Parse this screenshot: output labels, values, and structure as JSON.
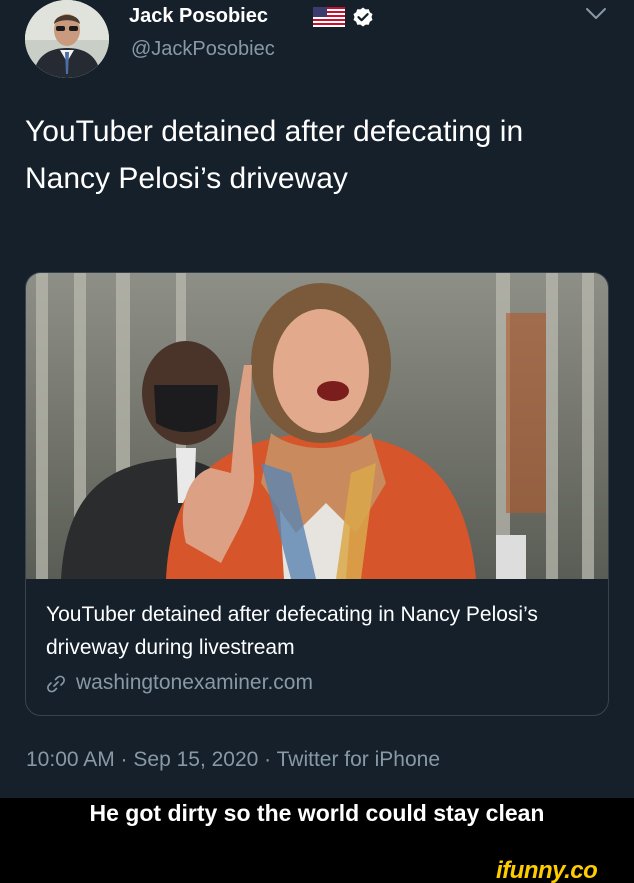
{
  "tweet": {
    "author_name": "Jack Posobiec",
    "author_handle": "@JackPosobiec",
    "text": "YouTuber detained after defecating in Nancy Pelosi’s driveway",
    "timestamp": "10:00 AM · Sep 15, 2020 · Twitter for iPhone",
    "icons": [
      "avatar",
      "us-flag-icon",
      "verified-badge-icon",
      "chevron-down-icon",
      "link-icon"
    ],
    "colors": {
      "background": "#15202b",
      "text": "#ffffff",
      "secondary_text": "#8899a6",
      "verified": "#ffffff",
      "card_border": "#38444d"
    }
  },
  "card": {
    "title": "YouTuber detained after defecating in Nancy Pelosi’s driveway during livestream",
    "domain": "washingtonexaminer.com"
  },
  "caption": {
    "text": "He got dirty so the world could stay clean"
  },
  "watermark": {
    "text": "ifunny.co",
    "color": "#ffcc00"
  }
}
